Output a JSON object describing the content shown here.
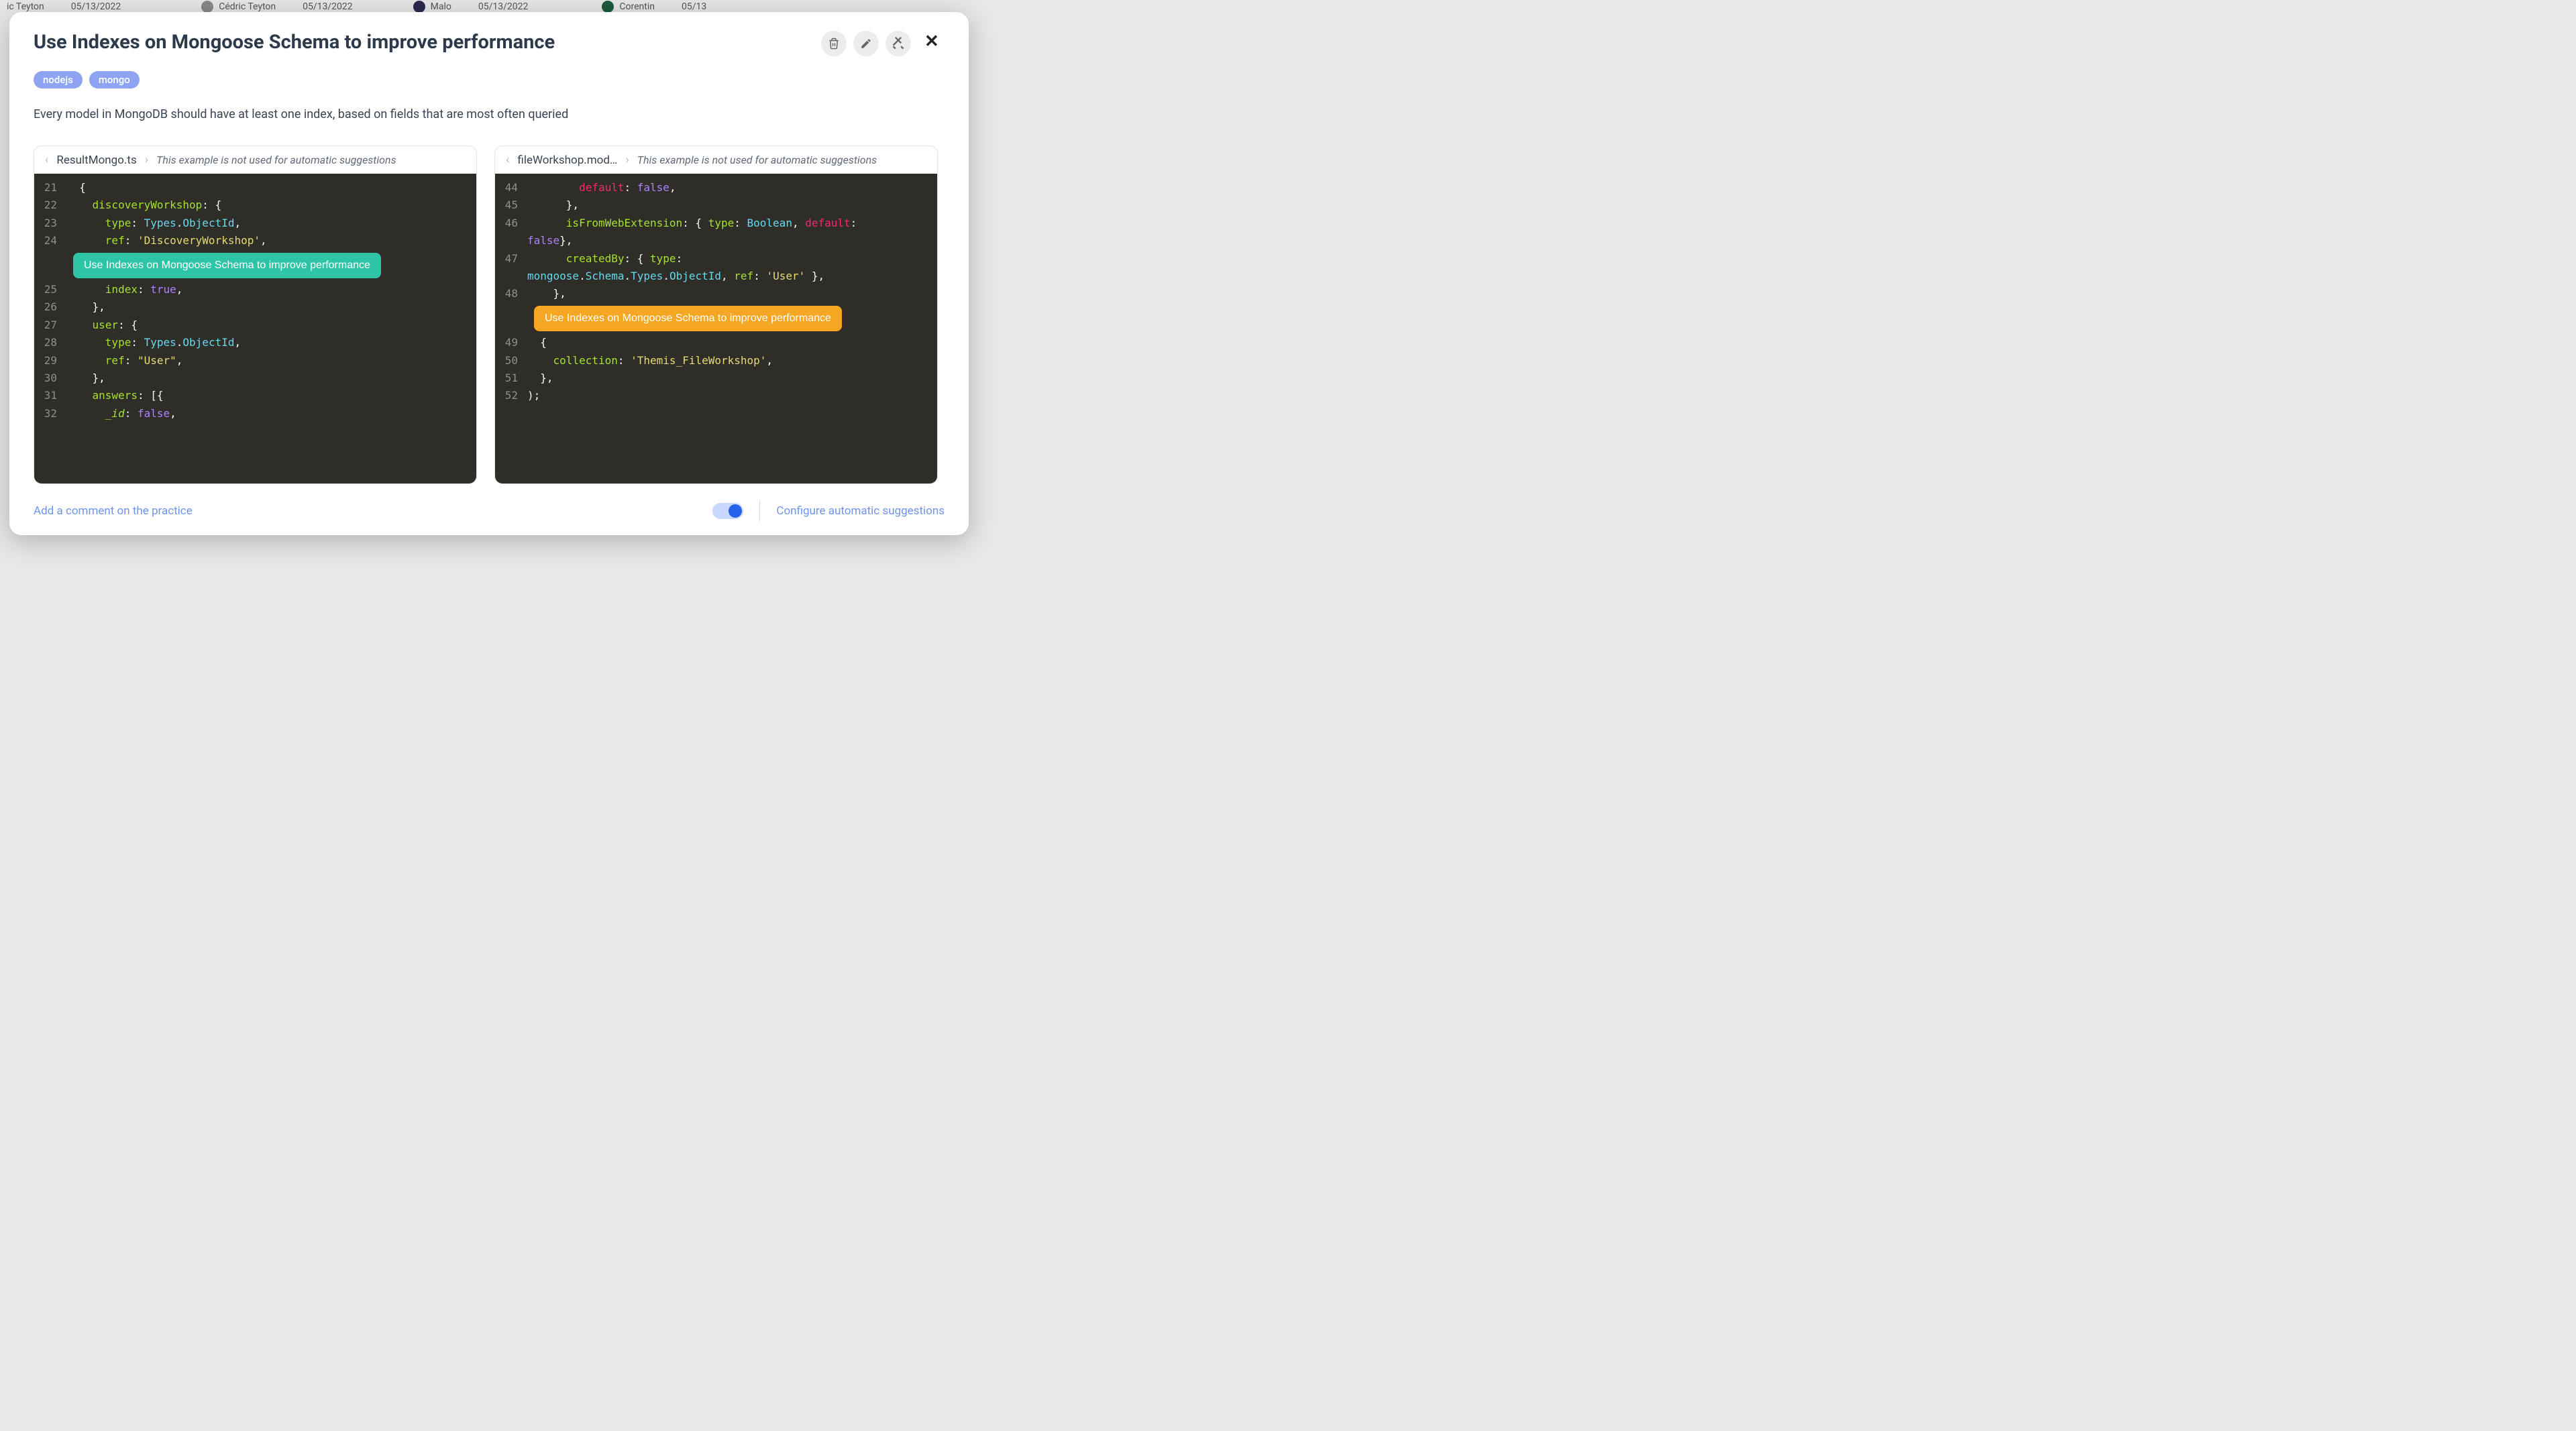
{
  "bg": {
    "r1_name": "ic Teyton",
    "r1_date": "05/13/2022",
    "r2_name": "Cédric Teyton",
    "r2_date": "05/13/2022",
    "r3_name": "Malo",
    "r3_date": "05/13/2022",
    "r4_name": "Corentin",
    "r4_date": "05/13"
  },
  "modal": {
    "title": "Use Indexes on Mongoose Schema to improve performance",
    "tags": {
      "t1": "nodejs",
      "t2": "mongo"
    },
    "description": "Every model in MongoDB should have at least one index, based on fields that are most often queried"
  },
  "ex1": {
    "filename": "ResultMongo.ts",
    "note": "This example is not used for automatic suggestions",
    "pill": "Use Indexes on Mongoose Schema to improve performance",
    "lines": {
      "n21": "21",
      "c21": "  {",
      "n22": "22",
      "n23": "23",
      "n24": "24",
      "n25": "25",
      "n26": "26",
      "c26": "    },",
      "n27": "27",
      "n28": "28",
      "n29": "29",
      "n30": "30",
      "c30": "    },",
      "n31": "31",
      "n32": "32"
    },
    "tokens": {
      "l22_a": "    discoveryWorkshop",
      "l22_b": ": {",
      "l23_a": "      type",
      "l23_b": ": ",
      "l23_c": "Types",
      "l23_d": ".",
      "l23_e": "ObjectId",
      "l23_f": ",",
      "l24_a": "      ref",
      "l24_b": ": ",
      "l24_c": "'DiscoveryWorkshop'",
      "l24_d": ",",
      "l25_a": "      index",
      "l25_b": ": ",
      "l25_c": "true",
      "l25_d": ",",
      "l27_a": "    user",
      "l27_b": ": {",
      "l28_a": "      type",
      "l28_b": ": ",
      "l28_c": "Types",
      "l28_d": ".",
      "l28_e": "ObjectId",
      "l28_f": ",",
      "l29_a": "      ref",
      "l29_b": ": ",
      "l29_c": "\"User\"",
      "l29_d": ",",
      "l31_a": "    answers",
      "l31_b": ": [{",
      "l32_a": "      _id",
      "l32_b": ": ",
      "l32_c": "false",
      "l32_d": ","
    }
  },
  "ex2": {
    "filename": "fileWorkshop.mod…",
    "note": "This example is not used for automatic suggestions",
    "pill": "Use Indexes on Mongoose Schema to improve performance",
    "lines": {
      "n44": "44",
      "n45": "45",
      "c45": "      },",
      "n46": "46",
      "n46w": "false",
      "n47": "47",
      "n48": "48",
      "c48": "    },",
      "n49": "49",
      "c49": "  {",
      "n50": "50",
      "n51": "51",
      "c51": "  },",
      "n52": "52",
      "c52": ");"
    },
    "tokens": {
      "l44_a": "        default",
      "l44_b": ": ",
      "l44_c": "false",
      "l44_d": ",",
      "l46_a": "      isFromWebExtension",
      "l46_b": ": { ",
      "l46_c": "type",
      "l46_d": ": ",
      "l46_e": "Boolean",
      "l46_f": ", ",
      "l46_g": "default",
      "l46_h": ": ",
      "l46w_b": "},",
      "l47_a": "      createdBy",
      "l47_b": ": { ",
      "l47_c": "type",
      "l47_d": ": ",
      "l47w_a": "mongoose",
      "l47w_b": ".",
      "l47w_c": "Schema",
      "l47w_d": ".",
      "l47w_e": "Types",
      "l47w_f": ".",
      "l47w_g": "ObjectId",
      "l47w_h": ", ",
      "l47w_i": "ref",
      "l47w_j": ": ",
      "l47w_k": "'User'",
      "l47w_l": " },",
      "l50_a": "    collection",
      "l50_b": ": ",
      "l50_c": "'Themis_FileWorkshop'",
      "l50_d": ","
    }
  },
  "footer": {
    "comment": "Add a comment on the practice",
    "config": "Configure automatic suggestions"
  }
}
